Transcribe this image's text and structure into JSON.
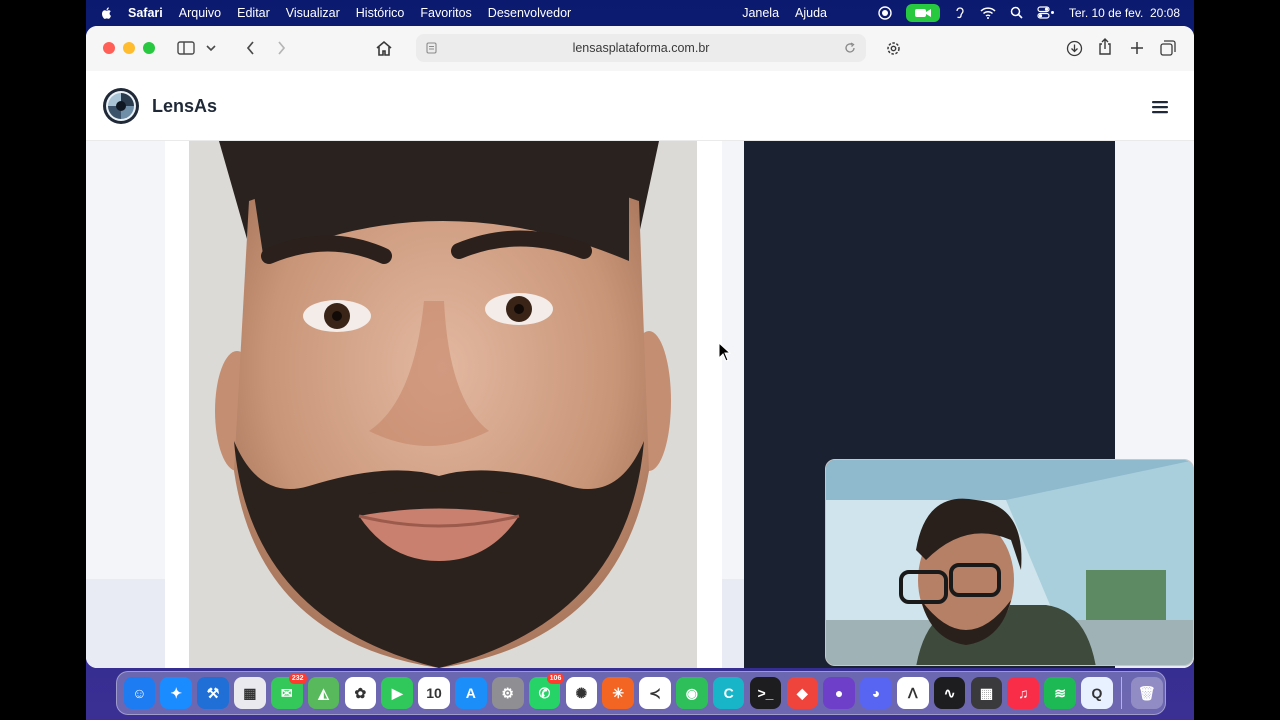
{
  "menubar": {
    "app": "Safari",
    "items": [
      "Arquivo",
      "Editar",
      "Visualizar",
      "Histórico",
      "Favoritos",
      "Desenvolvedor"
    ],
    "right_items": [
      "Janela",
      "Ajuda"
    ],
    "datetime": "Ter. 10 de fev.  20:08"
  },
  "browser": {
    "url": "lensasplataforma.com.br"
  },
  "site": {
    "brand": "LensAs"
  },
  "dock": {
    "apps": [
      {
        "name": "finder",
        "color": "#1e7cf2",
        "glyph": "☺"
      },
      {
        "name": "safari",
        "color": "#1a8cff",
        "glyph": "✦"
      },
      {
        "name": "xcode",
        "color": "#1f6fd6",
        "glyph": "⚒"
      },
      {
        "name": "launchpad",
        "color": "#e9e9ee",
        "glyph": "▦"
      },
      {
        "name": "messages",
        "color": "#34c759",
        "glyph": "✉",
        "badge": "232"
      },
      {
        "name": "maps",
        "color": "#58b85c",
        "glyph": "◭"
      },
      {
        "name": "photos",
        "color": "#ffffff",
        "glyph": "✿"
      },
      {
        "name": "facetime",
        "color": "#30c85a",
        "glyph": "▶"
      },
      {
        "name": "calendar",
        "color": "#ffffff",
        "glyph": "10"
      },
      {
        "name": "app-store",
        "color": "#1c8ef9",
        "glyph": "A"
      },
      {
        "name": "system-settings",
        "color": "#8e8e93",
        "glyph": "⚙"
      },
      {
        "name": "whatsapp",
        "color": "#25d366",
        "glyph": "✆",
        "badge": "106"
      },
      {
        "name": "chatgpt",
        "color": "#ffffff",
        "glyph": "✺"
      },
      {
        "name": "claude",
        "color": "#f26522",
        "glyph": "✳"
      },
      {
        "name": "vscode",
        "color": "#ffffff",
        "glyph": "≺"
      },
      {
        "name": "find-my",
        "color": "#2fbf5a",
        "glyph": "◉"
      },
      {
        "name": "canva",
        "color": "#18b5c9",
        "glyph": "C"
      },
      {
        "name": "terminal",
        "color": "#1d1d1f",
        "glyph": ">_"
      },
      {
        "name": "anydesk",
        "color": "#ef443b",
        "glyph": "◆"
      },
      {
        "name": "github-desktop",
        "color": "#6e40c9",
        "glyph": "●"
      },
      {
        "name": "discord",
        "color": "#5865f2",
        "glyph": "◕"
      },
      {
        "name": "ollama",
        "color": "#ffffff",
        "glyph": "ᐱ"
      },
      {
        "name": "activity-monitor",
        "color": "#1d1d1f",
        "glyph": "∿"
      },
      {
        "name": "calculator",
        "color": "#3a3a3c",
        "glyph": "▦"
      },
      {
        "name": "music",
        "color": "#fa2d48",
        "glyph": "♫"
      },
      {
        "name": "spotify",
        "color": "#1db954",
        "glyph": "≋"
      },
      {
        "name": "quicktime",
        "color": "#e8f1ff",
        "glyph": "Q"
      }
    ],
    "trash": {
      "name": "trash",
      "glyph": "🗑"
    }
  }
}
